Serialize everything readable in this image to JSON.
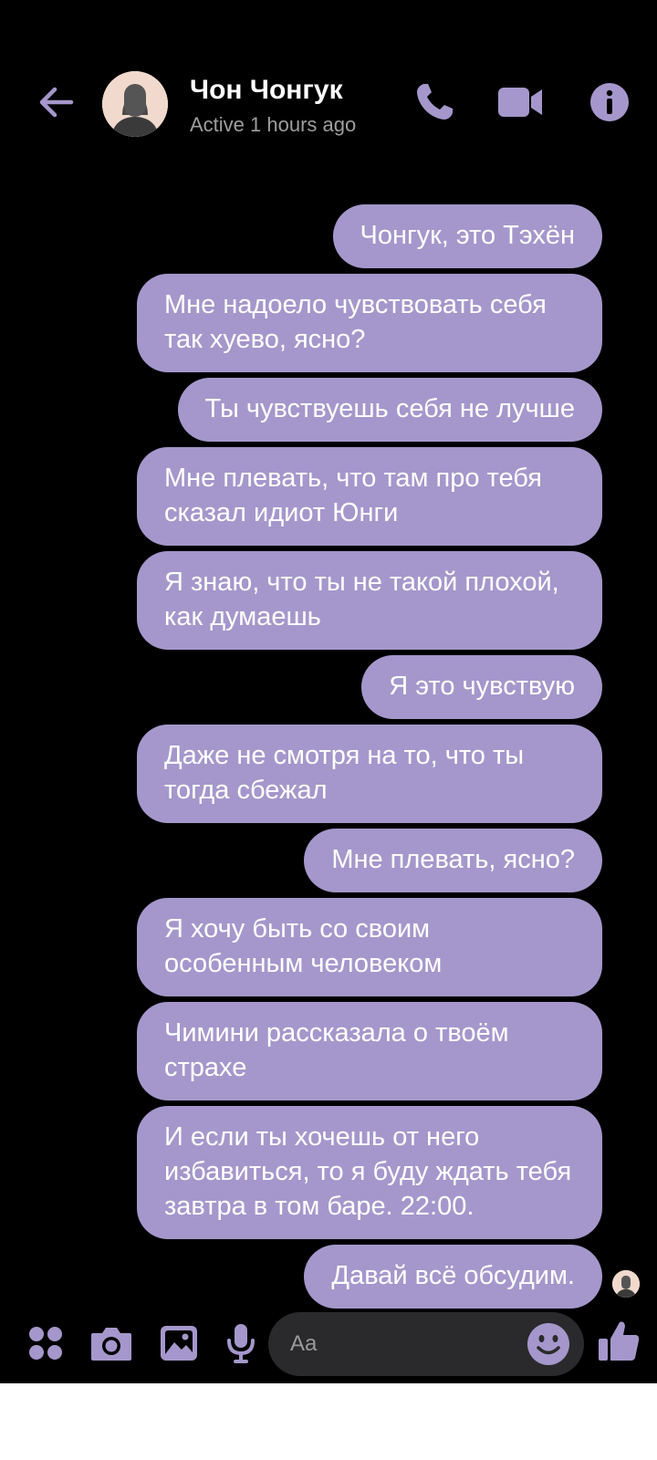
{
  "header": {
    "contact_name": "Чон Чонгук",
    "status": "Active 1 hours ago"
  },
  "messages": [
    {
      "text": "Чонгук, это Тэхён",
      "multiline": false
    },
    {
      "text": "Мне надоело чувствовать себя так хуево, ясно?",
      "multiline": true
    },
    {
      "text": "Ты чувствуешь себя не лучше",
      "multiline": false
    },
    {
      "text": "Мне плевать, что там про тебя сказал идиот Юнги",
      "multiline": true
    },
    {
      "text": "Я знаю, что ты не такой плохой, как думаешь",
      "multiline": true
    },
    {
      "text": "Я это чувствую",
      "multiline": false
    },
    {
      "text": "Даже не смотря на то, что ты тогда сбежал",
      "multiline": true
    },
    {
      "text": "Мне плевать, ясно?",
      "multiline": false
    },
    {
      "text": "Я хочу быть со своим особенным человеком",
      "multiline": true
    },
    {
      "text": "Чимини рассказала о твоём страхе",
      "multiline": true
    },
    {
      "text": "И если ты хочешь от него избавиться, то я буду ждать тебя завтра в том баре. 22:00.",
      "multiline": true
    },
    {
      "text": "Давай всё обсудим.",
      "multiline": false
    }
  ],
  "composer": {
    "placeholder": "Aa"
  },
  "colors": {
    "accent": "#a597cb",
    "background": "#000000",
    "input_bg": "#2a2a2c",
    "status_text": "#9e9e9e"
  },
  "icons": [
    "back-arrow-icon",
    "phone-icon",
    "video-camera-icon",
    "info-icon",
    "apps-icon",
    "camera-icon",
    "image-icon",
    "microphone-icon",
    "emoji-icon",
    "thumbs-up-icon"
  ]
}
